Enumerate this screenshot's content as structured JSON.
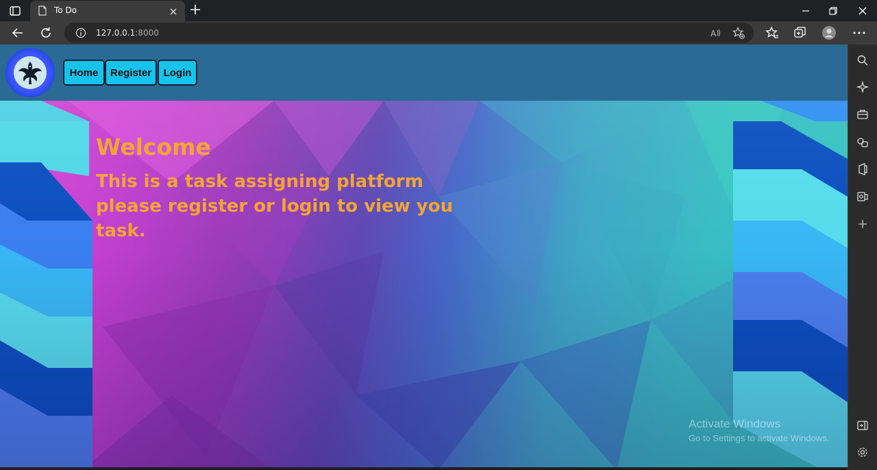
{
  "browser": {
    "tab_title": "To Do",
    "url_host": "127.0.0.1",
    "url_port": ":8000"
  },
  "site": {
    "nav": [
      {
        "label": "Home"
      },
      {
        "label": "Register"
      },
      {
        "label": "Login"
      }
    ],
    "heading": "Welcome",
    "subtitle": "This is a task assigning platform please register or login to view you task."
  },
  "os_watermark": {
    "title": "Activate Windows",
    "subtitle": "Go to Settings to activate Windows."
  },
  "colors": {
    "header_bg": "#2a6a94",
    "nav_button_bg": "#17c3ec",
    "heading_text": "#f4a436"
  },
  "icons": {
    "tab_actions": "tab-actions-icon",
    "favicon": "page-icon",
    "close": "close-icon",
    "new_tab": "plus-icon",
    "back": "back-arrow-icon",
    "refresh": "refresh-icon",
    "site_info": "info-icon",
    "read_aloud": "read-aloud-icon",
    "add_favorite": "star-plus-icon",
    "favorites": "favorites-icon",
    "collections": "collections-icon",
    "profile": "profile-icon",
    "more": "more-icon"
  }
}
